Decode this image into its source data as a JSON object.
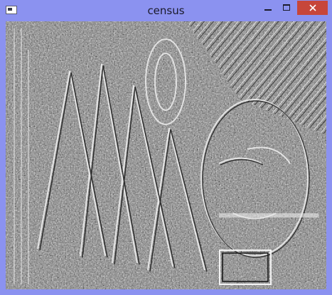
{
  "window": {
    "title": "census",
    "frame_color": "#8b92f0",
    "close_color": "#c7463a"
  },
  "icons": {
    "app": "app-icon",
    "minimize": "minimize-icon",
    "maximize": "maximize-icon",
    "close": "close-icon"
  },
  "image": {
    "description_kind": "embossed-grayscale-filter-output"
  }
}
